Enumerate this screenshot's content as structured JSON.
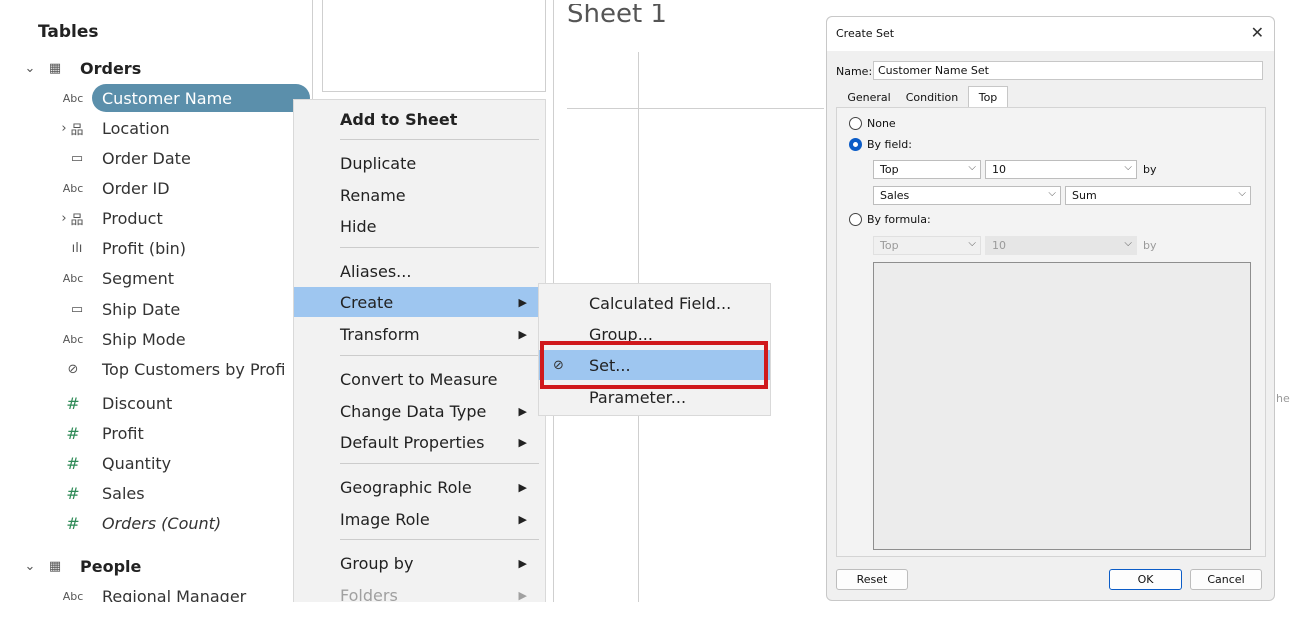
{
  "data_pane": {
    "title": "Tables",
    "tables": [
      {
        "name": "Orders",
        "fields": [
          {
            "type": "Abc",
            "name": "Customer Name"
          },
          {
            "name": "Location"
          },
          {
            "name": "Order Date"
          },
          {
            "type": "Abc",
            "name": "Order ID"
          },
          {
            "name": "Product"
          },
          {
            "name": "Profit (bin)"
          },
          {
            "type": "Abc",
            "name": "Segment"
          },
          {
            "name": "Ship Date"
          },
          {
            "type": "Abc",
            "name": "Ship Mode"
          },
          {
            "name": "Top Customers by Profi"
          },
          {
            "type": "#",
            "name": "Discount"
          },
          {
            "type": "#",
            "name": "Profit"
          },
          {
            "type": "#",
            "name": "Quantity"
          },
          {
            "type": "#",
            "name": "Sales"
          },
          {
            "type": "#",
            "name": "Orders (Count)"
          }
        ]
      },
      {
        "name": "People",
        "fields": [
          {
            "type": "Abc",
            "name": "Regional Manager"
          }
        ]
      }
    ]
  },
  "sheet": {
    "title": "Sheet 1",
    "stray_text": "he"
  },
  "context_menu": {
    "items": [
      "Add to Sheet",
      "Duplicate",
      "Rename",
      "Hide",
      "Aliases...",
      "Create",
      "Transform",
      "Convert to Measure",
      "Change Data Type",
      "Default Properties",
      "Geographic Role",
      "Image Role",
      "Group by",
      "Folders"
    ]
  },
  "create_submenu": {
    "items": [
      "Calculated Field...",
      "Group...",
      "Set...",
      "Parameter..."
    ]
  },
  "dialog": {
    "title": "Create Set",
    "name_label": "Name:",
    "name_value": "Customer Name Set",
    "tabs": [
      "General",
      "Condition",
      "Top"
    ],
    "none_label": "None",
    "by_field_label": "By field:",
    "by_field": {
      "direction": "Top",
      "count": "10",
      "by": "by",
      "field": "Sales",
      "aggregation": "Sum"
    },
    "by_formula_label": "By formula:",
    "by_formula": {
      "direction": "Top",
      "count": "10",
      "by": "by"
    },
    "reset_label": "Reset",
    "ok_label": "OK",
    "cancel_label": "Cancel"
  }
}
